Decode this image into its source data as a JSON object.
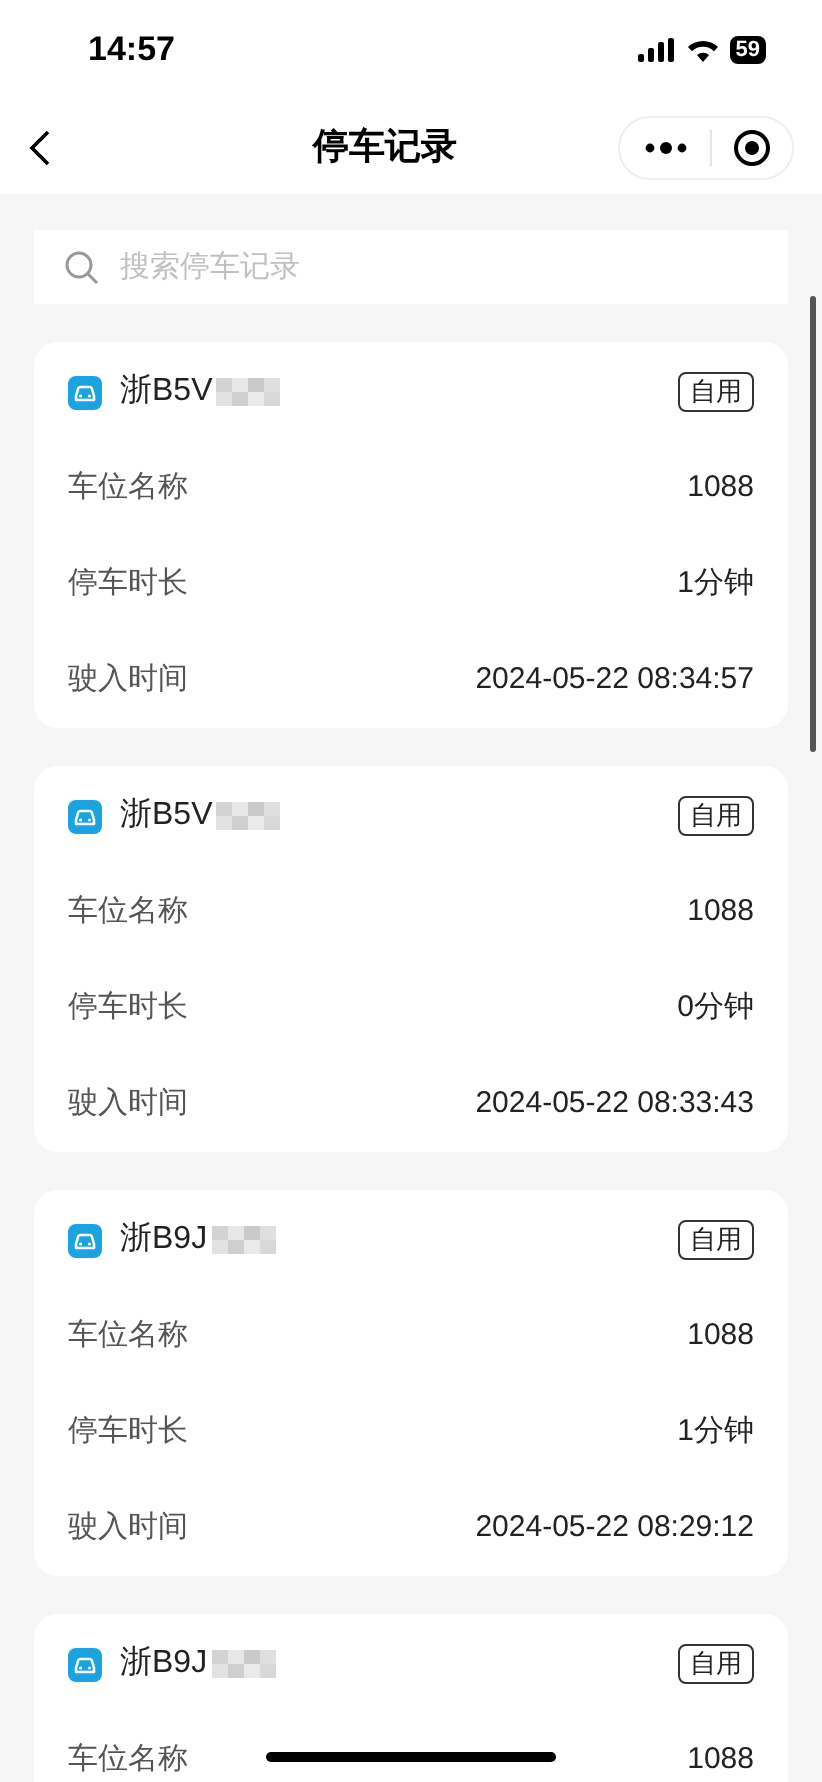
{
  "status_bar": {
    "time": "14:57",
    "battery": "59"
  },
  "nav": {
    "title": "停车记录"
  },
  "search": {
    "placeholder": "搜索停车记录"
  },
  "records": [
    {
      "plate": "浙B5V",
      "tag": "自用",
      "rows": [
        {
          "label": "车位名称",
          "value": "1088"
        },
        {
          "label": "停车时长",
          "value": "1分钟"
        },
        {
          "label": "驶入时间",
          "value": "2024-05-22 08:34:57"
        }
      ]
    },
    {
      "plate": "浙B5V",
      "tag": "自用",
      "rows": [
        {
          "label": "车位名称",
          "value": "1088"
        },
        {
          "label": "停车时长",
          "value": "0分钟"
        },
        {
          "label": "驶入时间",
          "value": "2024-05-22 08:33:43"
        }
      ]
    },
    {
      "plate": "浙B9J",
      "tag": "自用",
      "rows": [
        {
          "label": "车位名称",
          "value": "1088"
        },
        {
          "label": "停车时长",
          "value": "1分钟"
        },
        {
          "label": "驶入时间",
          "value": "2024-05-22 08:29:12"
        }
      ]
    },
    {
      "plate": "浙B9J",
      "tag": "自用",
      "rows": [
        {
          "label": "车位名称",
          "value": "1088"
        }
      ]
    }
  ]
}
